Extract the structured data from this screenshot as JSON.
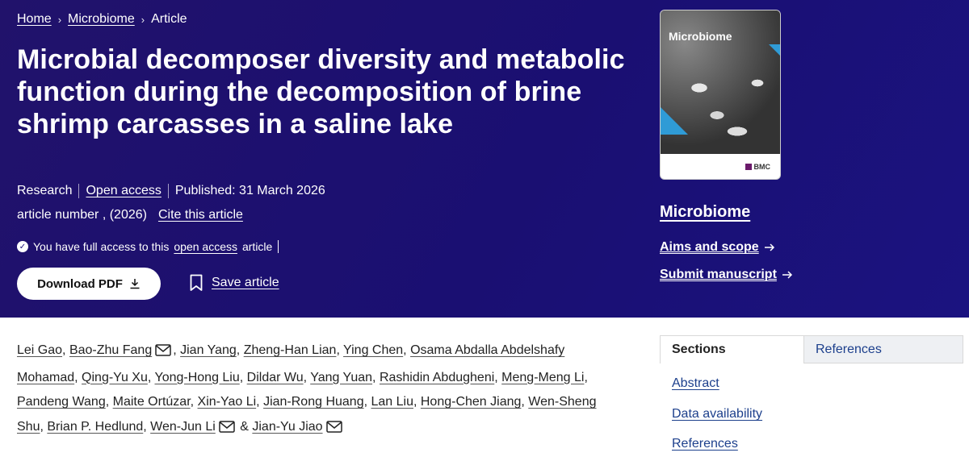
{
  "breadcrumb": {
    "home": "Home",
    "journal": "Microbiome",
    "current": "Article",
    "sep": "›"
  },
  "article": {
    "title": "Microbial decomposer diversity and metabolic function during the decomposition of brine shrimp carcasses in a saline lake",
    "type": "Research",
    "access_label": "Open access",
    "published": "Published: 31 March 2026",
    "article_number": "article number , (2026)",
    "cite_label": "Cite this article",
    "access_note_prefix": "You have full access to this",
    "access_note_link": "open access",
    "access_note_suffix": "article",
    "download_label": "Download PDF",
    "save_label": "Save article"
  },
  "journal": {
    "cover_title": "Microbiome",
    "publisher": "BMC",
    "name": "Microbiome",
    "aims_label": "Aims and scope",
    "submit_label": "Submit manuscript"
  },
  "authors": [
    {
      "name": "Lei Gao",
      "email": false
    },
    {
      "name": "Bao-Zhu Fang",
      "email": true
    },
    {
      "name": "Jian Yang",
      "email": false
    },
    {
      "name": "Zheng-Han Lian",
      "email": false
    },
    {
      "name": "Ying Chen",
      "email": false
    },
    {
      "name": "Osama Abdalla Abdelshafy Mohamad",
      "email": false
    },
    {
      "name": "Qing-Yu Xu",
      "email": false
    },
    {
      "name": "Yong-Hong Liu",
      "email": false
    },
    {
      "name": "Dildar Wu",
      "email": false
    },
    {
      "name": "Yang Yuan",
      "email": false
    },
    {
      "name": "Rashidin Abdugheni",
      "email": false
    },
    {
      "name": "Meng-Meng Li",
      "email": false
    },
    {
      "name": "Pandeng Wang",
      "email": false
    },
    {
      "name": "Maite Ortúzar",
      "email": false
    },
    {
      "name": "Xin-Yao Li",
      "email": false
    },
    {
      "name": "Jian-Rong Huang",
      "email": false
    },
    {
      "name": "Lan Liu",
      "email": false
    },
    {
      "name": "Hong-Chen Jiang",
      "email": false
    },
    {
      "name": "Wen-Sheng Shu",
      "email": false
    },
    {
      "name": "Brian P. Hedlund",
      "email": false
    },
    {
      "name": "Wen-Jun Li",
      "email": true
    },
    {
      "name": "Jian-Yu Jiao",
      "email": true
    }
  ],
  "authors_last_sep": "&",
  "tabs": {
    "sections": "Sections",
    "references": "References"
  },
  "sections": {
    "abstract": "Abstract",
    "data": "Data availability",
    "references": "References"
  },
  "icons": {
    "breadcrumb_sep": "chevron-right-icon",
    "check": "check-circle-icon",
    "download": "download-icon",
    "bookmark": "bookmark-icon",
    "arrow": "arrow-right-icon",
    "mail": "mail-icon"
  },
  "colors": {
    "hero_bg": "#1c1078",
    "link_blue": "#1c3f8c"
  }
}
